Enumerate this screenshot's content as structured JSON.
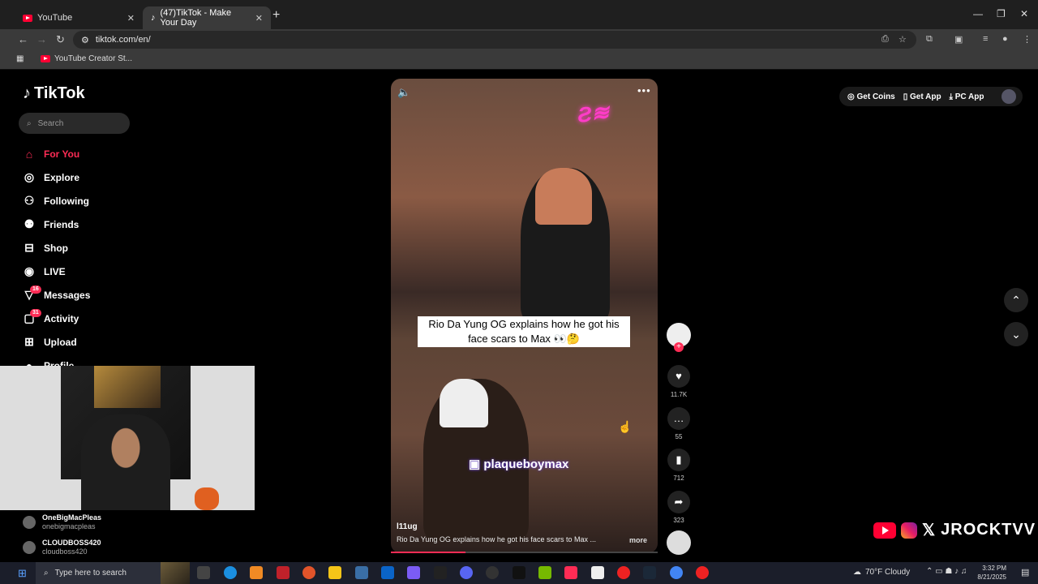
{
  "browser": {
    "tabs": [
      {
        "title": "YouTube",
        "active": false
      },
      {
        "title": "(47)TikTok - Make Your Day",
        "active": true
      }
    ],
    "url": "tiktok.com/en/",
    "bookmarks": [
      {
        "label": "YouTube Creator St..."
      }
    ]
  },
  "tiktok": {
    "logo": "TikTok",
    "search_placeholder": "Search",
    "nav": [
      {
        "label": "For You",
        "icon": "home-icon",
        "active": true
      },
      {
        "label": "Explore",
        "icon": "compass-icon"
      },
      {
        "label": "Following",
        "icon": "following-icon"
      },
      {
        "label": "Friends",
        "icon": "friends-icon"
      },
      {
        "label": "Shop",
        "icon": "shop-icon"
      },
      {
        "label": "LIVE",
        "icon": "live-icon"
      },
      {
        "label": "Messages",
        "icon": "messages-icon",
        "badge": "16"
      },
      {
        "label": "Activity",
        "icon": "activity-icon",
        "badge": "31"
      },
      {
        "label": "Upload",
        "icon": "upload-icon"
      },
      {
        "label": "Profile",
        "icon": "profile-icon"
      }
    ],
    "following_accounts": [
      {
        "name": "OneBigMacPleas",
        "handle": "onebigmacpleas"
      },
      {
        "name": "CLOUDBOSS420",
        "handle": "cloudboss420"
      }
    ],
    "top_right": {
      "get_coins": "Get Coins",
      "get_app": "Get App",
      "pc_app": "PC App"
    },
    "video": {
      "caption": "Rio Da Yung OG explains how he got his face scars to Max 👀🤔",
      "overlay_handle": "plaqueboymax",
      "author": "l11ug",
      "description": "Rio Da Yung OG explains how he got his face scars to Max ...",
      "more": "more",
      "progress": 0.28
    },
    "actions": {
      "likes": "11.7K",
      "comments": "55",
      "saves": "712",
      "shares": "323"
    }
  },
  "watermark": "JROCKTVV",
  "taskbar": {
    "search_placeholder": "Type here to search",
    "weather": "70°F  Cloudy",
    "time": "3:32 PM",
    "date": "8/21/2025"
  }
}
